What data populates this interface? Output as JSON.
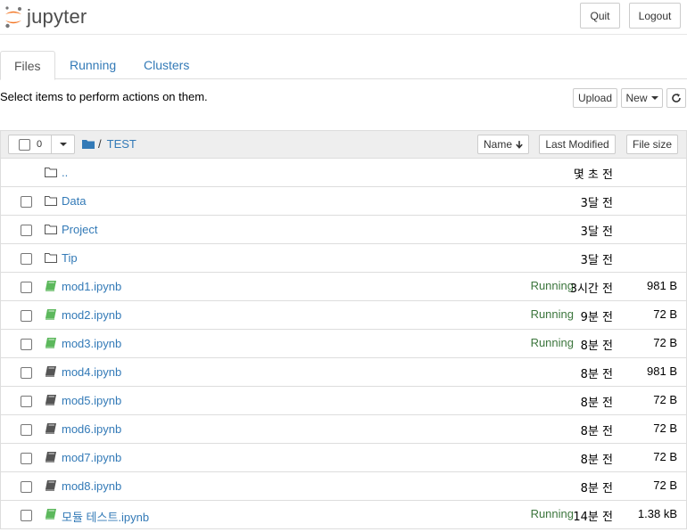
{
  "header": {
    "logo_text": "jupyter",
    "quit_label": "Quit",
    "logout_label": "Logout"
  },
  "tabs": [
    {
      "label": "Files",
      "active": true
    },
    {
      "label": "Running",
      "active": false
    },
    {
      "label": "Clusters",
      "active": false
    }
  ],
  "toolbar": {
    "instructions": "Select items to perform actions on them.",
    "upload_label": "Upload",
    "new_label": "New"
  },
  "list_header": {
    "selected_count": "0",
    "breadcrumb_sep": "/",
    "breadcrumb_folder": "TEST",
    "name_label": "Name",
    "last_modified_label": "Last Modified",
    "file_size_label": "File size"
  },
  "colors": {
    "link": "#337ab7",
    "running": "#3c763d",
    "notebook_running_icon": "#5cb85c",
    "notebook_icon": "#555555"
  },
  "items": [
    {
      "name": "..",
      "type": "folder",
      "running": "",
      "modified": "몇 초 전",
      "size": ""
    },
    {
      "name": "Data",
      "type": "folder",
      "running": "",
      "modified": "3달 전",
      "size": ""
    },
    {
      "name": "Project",
      "type": "folder",
      "running": "",
      "modified": "3달 전",
      "size": ""
    },
    {
      "name": "Tip",
      "type": "folder",
      "running": "",
      "modified": "3달 전",
      "size": ""
    },
    {
      "name": "mod1.ipynb",
      "type": "notebook-running",
      "running": "Running",
      "modified": "3시간 전",
      "size": "981 B"
    },
    {
      "name": "mod2.ipynb",
      "type": "notebook-running",
      "running": "Running",
      "modified": "9분 전",
      "size": "72 B"
    },
    {
      "name": "mod3.ipynb",
      "type": "notebook-running",
      "running": "Running",
      "modified": "8분 전",
      "size": "72 B"
    },
    {
      "name": "mod4.ipynb",
      "type": "notebook",
      "running": "",
      "modified": "8분 전",
      "size": "981 B"
    },
    {
      "name": "mod5.ipynb",
      "type": "notebook",
      "running": "",
      "modified": "8분 전",
      "size": "72 B"
    },
    {
      "name": "mod6.ipynb",
      "type": "notebook",
      "running": "",
      "modified": "8분 전",
      "size": "72 B"
    },
    {
      "name": "mod7.ipynb",
      "type": "notebook",
      "running": "",
      "modified": "8분 전",
      "size": "72 B"
    },
    {
      "name": "mod8.ipynb",
      "type": "notebook",
      "running": "",
      "modified": "8분 전",
      "size": "72 B"
    },
    {
      "name": "모듈 테스트.ipynb",
      "type": "notebook-running",
      "running": "Running",
      "modified": "14분 전",
      "size": "1.38 kB"
    }
  ]
}
